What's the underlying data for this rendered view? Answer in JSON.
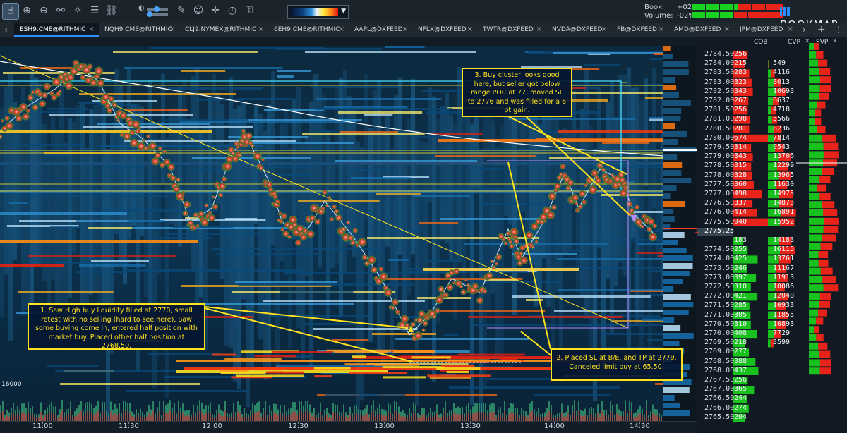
{
  "toolbar": {
    "tools": [
      {
        "name": "pointer-icon",
        "glyph": "☝",
        "active": true
      },
      {
        "name": "zoom-in-icon",
        "glyph": "⊕"
      },
      {
        "name": "zoom-out-icon",
        "glyph": "⊖"
      },
      {
        "name": "share-icon",
        "glyph": "⚯"
      },
      {
        "name": "magic-wand-icon",
        "glyph": "✧"
      },
      {
        "name": "layers-icon",
        "glyph": "☰"
      },
      {
        "name": "link-icon",
        "glyph": "⛓"
      }
    ],
    "tools2": [
      {
        "name": "pencil-icon",
        "glyph": "✎"
      },
      {
        "name": "chat-icon",
        "glyph": "☺"
      },
      {
        "name": "crosshair-icon",
        "glyph": "✛"
      },
      {
        "name": "timer-icon",
        "glyph": "◷"
      },
      {
        "name": "lock-icon",
        "glyph": "⚿"
      }
    ],
    "book_label": "Book:",
    "book_value": "+02%",
    "volume_label": "Volume:",
    "volume_value": "-02%"
  },
  "logo": "BOOKMAP",
  "tabs": [
    {
      "label": "ESH9.CME@RITHMIC",
      "active": true
    },
    {
      "label": "NQH9.CME@RITHMIC"
    },
    {
      "label": "CLJ9.NYMEX@RITHMIC"
    },
    {
      "label": "6EH9.CME@RITHMIC"
    },
    {
      "label": "AAPL@DXFEED"
    },
    {
      "label": "NFLX@DXFEED"
    },
    {
      "label": "TWTR@DXFEED"
    },
    {
      "label": "NVDA@DXFEED"
    },
    {
      "label": "FB@DXFEED"
    },
    {
      "label": "AMD@DXFEED"
    },
    {
      "label": "JPM@DXFEED"
    }
  ],
  "tab_nav": {
    "prev": "‹",
    "next": "›",
    "add": "+",
    "more": "⋮"
  },
  "ladder_headers": {
    "cob": "COB",
    "cvp": "CVP",
    "svp": "SVP"
  },
  "ladder": [
    {
      "price": "2784.50",
      "size": "256",
      "cvp": ""
    },
    {
      "price": "2784.00",
      "size": "215",
      "cvp": "549"
    },
    {
      "price": "2783.50",
      "size": "283",
      "cvp": "4116"
    },
    {
      "price": "2783.00",
      "size": "323",
      "cvp": "8013"
    },
    {
      "price": "2782.50",
      "size": "343",
      "cvp": "10693"
    },
    {
      "price": "2782.00",
      "size": "267",
      "cvp": "6637"
    },
    {
      "price": "2781.50",
      "size": "256",
      "cvp": "4718"
    },
    {
      "price": "2781.00",
      "size": "298",
      "cvp": "5566"
    },
    {
      "price": "2780.50",
      "size": "281",
      "cvp": "8236"
    },
    {
      "price": "2780.00",
      "size": "674",
      "cvp": "7814"
    },
    {
      "price": "2779.50",
      "size": "314",
      "cvp": "9543"
    },
    {
      "price": "2779.00",
      "size": "343",
      "cvp": "13706"
    },
    {
      "price": "2778.50",
      "size": "315",
      "cvp": "12299"
    },
    {
      "price": "2778.00",
      "size": "328",
      "cvp": "13965"
    },
    {
      "price": "2777.50",
      "size": "360",
      "cvp": "11630"
    },
    {
      "price": "2777.00",
      "size": "498",
      "cvp": "14975"
    },
    {
      "price": "2776.50",
      "size": "337",
      "cvp": "14873"
    },
    {
      "price": "2776.00",
      "size": "414",
      "cvp": "16891"
    },
    {
      "price": "2775.50",
      "size": "940",
      "cvp": "15952"
    },
    {
      "price": "2775.25",
      "size": "",
      "cvp": ""
    },
    {
      "price": "",
      "size": "183",
      "cvp": "14183"
    },
    {
      "price": "2774.50",
      "size": "255",
      "cvp": "16115"
    },
    {
      "price": "2774.00",
      "size": "425",
      "cvp": "13761"
    },
    {
      "price": "2773.50",
      "size": "246",
      "cvp": "11167"
    },
    {
      "price": "2773.00",
      "size": "397",
      "cvp": "11913"
    },
    {
      "price": "2772.50",
      "size": "310",
      "cvp": "10086"
    },
    {
      "price": "2772.00",
      "size": "421",
      "cvp": "12048"
    },
    {
      "price": "2771.50",
      "size": "285",
      "cvp": "10933"
    },
    {
      "price": "2771.00",
      "size": "305",
      "cvp": "11855"
    },
    {
      "price": "2770.50",
      "size": "310",
      "cvp": "10893"
    },
    {
      "price": "2770.00",
      "size": "408",
      "cvp": "7729"
    },
    {
      "price": "2769.50",
      "size": "218",
      "cvp": "3599"
    },
    {
      "price": "2769.00",
      "size": "277",
      "cvp": ""
    },
    {
      "price": "2768.50",
      "size": "388",
      "cvp": ""
    },
    {
      "price": "2768.00",
      "size": "437",
      "cvp": ""
    },
    {
      "price": "2767.50",
      "size": "256",
      "cvp": ""
    },
    {
      "price": "2767.00",
      "size": "365",
      "cvp": ""
    },
    {
      "price": "2766.50",
      "size": "244",
      "cvp": ""
    },
    {
      "price": "2766.00",
      "size": "274",
      "cvp": ""
    },
    {
      "price": "2765.50",
      "size": "204",
      "cvp": ""
    }
  ],
  "current_price_marker": "1",
  "time_labels": [
    "11:00",
    "11:30",
    "12:00",
    "12:30",
    "13:00",
    "13:30",
    "14:00",
    "14:30"
  ],
  "volume_scale": "16000",
  "annotations": {
    "note1": "1. Saw High buy liquidity filled at 2770, small retest with no selling (hard to see here). Saw some buying come in, entered half position with market buy. Placed other half position at 2768.50.",
    "note2": "2. Placed SL at B/E, and TP at 2779. Canceled limit buy at 65.50.",
    "note3": "3. Buy cluster looks good here, but seller got below range POC at 77, moved SL to 2776 and was filled for a 6 pt gain."
  },
  "colors": {
    "accent": "#2b8dff",
    "annotation": "#ffe21f",
    "bid": "#19d11f",
    "ask": "#ff2a1a",
    "background": "#0b1a26"
  }
}
